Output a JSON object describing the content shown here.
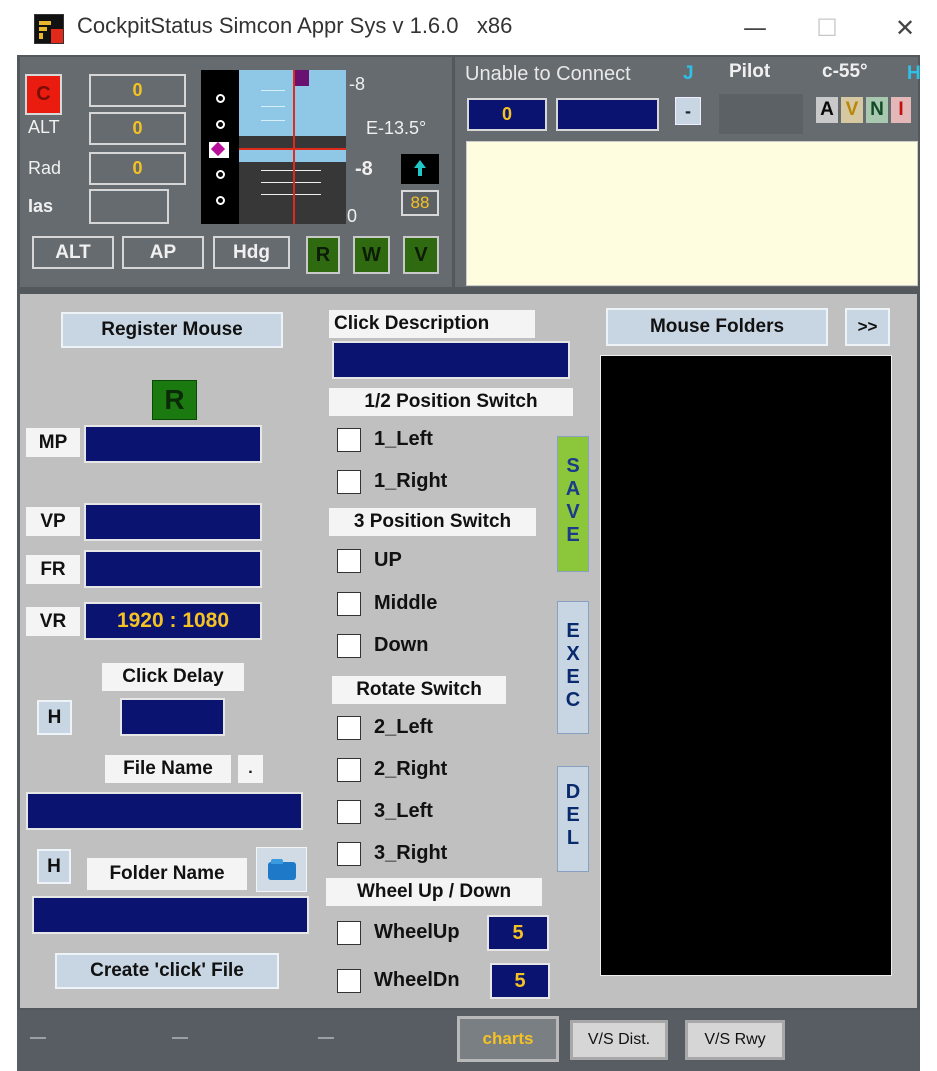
{
  "window": {
    "title": "CockpitStatus Simcon Appr Sys v 1.6.0   x86",
    "minimize": "—",
    "maximize": "☐",
    "close": "✕"
  },
  "instruments": {
    "c_button": "C",
    "c_value": "0",
    "alt_label": "ALT",
    "alt_value": "0",
    "rad_label": "Rad",
    "rad_value": "0",
    "ias_label": "Ias",
    "ias_value": "",
    "scale_top": "-8",
    "scale_mid": "-8",
    "scale_bottom": "0",
    "elevation_label": "E-13.5°",
    "arrow_value": "88",
    "alt_button": "ALT",
    "ap_button": "AP",
    "hdg_button": "Hdg",
    "r_button": "R",
    "w_button": "W",
    "v_button": "V"
  },
  "connection": {
    "status": "Unable to Connect",
    "j_label": "J",
    "pilot_label": "Pilot",
    "c_value": "c-55°",
    "h_label": "H",
    "count": "0",
    "field": "",
    "minus_button": "-",
    "mode_letters": [
      "A",
      "V",
      "N",
      "I"
    ],
    "message_area": ""
  },
  "mouse": {
    "register_button": "Register Mouse",
    "r_indicator": "R",
    "mp_label": "MP",
    "vp_label": "VP",
    "fr_label": "FR",
    "vr_label": "VR",
    "vr_value": "1920 : 1080",
    "click_delay_label": "Click Delay",
    "h_button": "H",
    "file_name_label": "File Name",
    "dot_button": ".",
    "folder_name_label": "Folder Name",
    "create_button": "Create 'click' File"
  },
  "click": {
    "description_label": "Click Description",
    "two_pos_label": "1/2  Position Switch",
    "opt_1_left": "1_Left",
    "opt_1_right": "1_Right",
    "three_pos_label": "3 Position Switch",
    "opt_up": "UP",
    "opt_middle": "Middle",
    "opt_down": "Down",
    "rotate_label": "Rotate Switch",
    "opt_2_left": "2_Left",
    "opt_2_right": "2_Right",
    "opt_3_left": "3_Left",
    "opt_3_right": "3_Right",
    "wheel_label": "Wheel Up / Down",
    "wheel_up": "WheelUp",
    "wheel_up_value": "5",
    "wheel_dn": "WheelDn",
    "wheel_dn_value": "5"
  },
  "actions": {
    "save": [
      "S",
      "A",
      "V",
      "E"
    ],
    "exec": [
      "E",
      "X",
      "E",
      "C"
    ],
    "del": [
      "D",
      "E",
      "L"
    ]
  },
  "folders": {
    "title_button": "Mouse Folders",
    "more_button": ">>"
  },
  "statusbar": {
    "charts": "charts",
    "vs_dist": "V/S Dist.",
    "vs_rwy": "V/S Rwy"
  },
  "colors": {
    "navy": "#0a1470",
    "gold": "#f5c224",
    "save_green": "#8cc63a",
    "red": "#e02a1c"
  }
}
